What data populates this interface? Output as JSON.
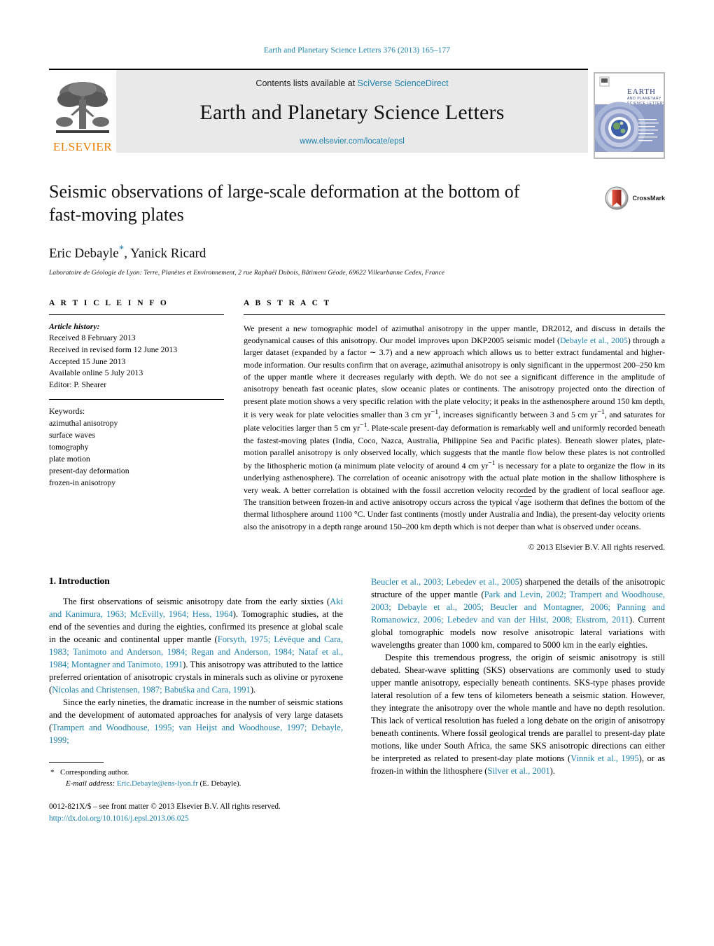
{
  "running_head": "Earth and Planetary Science Letters 376 (2013) 165–177",
  "masthead": {
    "contents_prefix": "Contents lists available at ",
    "sciencedirect_link": "SciVerse ScienceDirect",
    "journal_title": "Earth and Planetary Science Letters",
    "journal_url": "www.elsevier.com/locate/epsl",
    "publisher_wordmark": "ELSEVIER",
    "cover_title_line1": "EARTH",
    "cover_title_line2": "AND PLANETARY",
    "cover_title_line3": "SCIENCE LETTERS"
  },
  "article": {
    "title": "Seismic observations of large-scale deformation at the bottom of fast-moving plates",
    "authors": "Eric Debayle",
    "authors_rest": ", Yanick Ricard",
    "corresponding_marker": "*",
    "affiliation": "Laboratoire de Géologie de Lyon: Terre, Planètes et Environnement, 2 rue Raphaël Dubois, Bâtiment Géode, 69622 Villeurbanne Cedex, France",
    "crossmark_label": "CrossMark"
  },
  "article_info": {
    "heading": "A R T I C L E    I N F O",
    "history_label": "Article history:",
    "history": [
      "Received 8 February 2013",
      "Received in revised form 12 June 2013",
      "Accepted 15 June 2013",
      "Available online 5 July 2013",
      "Editor: P. Shearer"
    ],
    "keywords_label": "Keywords:",
    "keywords": [
      "azimuthal anisotropy",
      "surface waves",
      "tomography",
      "plate motion",
      "present-day deformation",
      "frozen-in anisotropy"
    ]
  },
  "abstract": {
    "heading": "A B S T R A C T",
    "p1": "We present a new tomographic model of azimuthal anisotropy in the upper mantle, DR2012, and discuss in details the geodynamical causes of this anisotropy. Our model improves upon DKP2005 seismic model (",
    "ref1": "Debayle et al., 2005",
    "p2": ") through a larger dataset (expanded by a factor ∼ 3.7) and a new approach which allows us to better extract fundamental and higher-mode information. Our results confirm that on average, azimuthal anisotropy is only significant in the uppermost 200–250 km of the upper mantle where it decreases regularly with depth. We do not see a significant difference in the amplitude of anisotropy beneath fast oceanic plates, slow oceanic plates or continents. The anisotropy projected onto the direction of present plate motion shows a very specific relation with the plate velocity; it peaks in the asthenosphere around 150 km depth, it is very weak for plate velocities smaller than 3 cm yr",
    "sup1": "−1",
    "p3": ", increases significantly between 3 and 5 cm yr",
    "sup2": "−1",
    "p4": ", and saturates for plate velocities larger than 5 cm yr",
    "sup3": "−1",
    "p5": ". Plate-scale present-day deformation is remarkably well and uniformly recorded beneath the fastest-moving plates (India, Coco, Nazca, Australia, Philippine Sea and Pacific plates). Beneath slower plates, plate-motion parallel anisotropy is only observed locally, which suggests that the mantle flow below these plates is not controlled by the lithospheric motion (a minimum plate velocity of around 4 cm yr",
    "sup4": "−1",
    "p6": " is necessary for a plate to organize the flow in its underlying asthenosphere). The correlation of oceanic anisotropy with the actual plate motion in the shallow lithosphere is very weak. A better correlation is obtained with the fossil accretion velocity recorded by the gradient of local seafloor age. The transition between frozen-in and active anisotropy occurs across the typical ",
    "sqrt_label": "age",
    "p7": " isotherm that defines the bottom of the thermal lithosphere around 1100 °C. Under fast continents (mostly under Australia and India), the present-day velocity orients also the anisotropy in a depth range around 150–200 km depth which is not deeper than what is observed under oceans.",
    "copyright": "© 2013 Elsevier B.V. All rights reserved."
  },
  "introduction": {
    "heading": "1. Introduction",
    "left_para1_a": "The first observations of seismic anisotropy date from the early sixties (",
    "left_para1_ref1": "Aki and Kanimura, 1963; McEvilly, 1964; Hess, 1964",
    "left_para1_b": "). Tomographic studies, at the end of the seventies and during the eighties, confirmed its presence at global scale in the oceanic and continental upper mantle (",
    "left_para1_ref2": "Forsyth, 1975; Lévêque and Cara, 1983; Tanimoto and Anderson, 1984; Regan and Anderson, 1984; Nataf et al., 1984; Montagner and Tanimoto, 1991",
    "left_para1_c": "). This anisotropy was attributed to the lattice preferred orientation of anisotropic crystals in minerals such as olivine or pyroxene (",
    "left_para1_ref3": "Nicolas and Christensen, 1987; Babuška and Cara, 1991",
    "left_para1_d": ").",
    "left_para2_a": "Since the early nineties, the dramatic increase in the number of seismic stations and the development of automated approaches for analysis of very large datasets (",
    "left_para2_ref1": "Trampert and Woodhouse, 1995; van Heijst and Woodhouse, 1997; Debayle, 1999;",
    "right_para1_ref1": "Beucler et al., 2003; Lebedev et al., 2005",
    "right_para1_a": ") sharpened the details of the anisotropic structure of the upper mantle (",
    "right_para1_ref2": "Park and Levin, 2002; Trampert and Woodhouse, 2003; Debayle et al., 2005; Beucler and Montagner, 2006; Panning and Romanowicz, 2006; Lebedev and van der Hilst, 2008; Ekstrom, 2011",
    "right_para1_b": "). Current global tomographic models now resolve anisotropic lateral variations with wavelengths greater than 1000 km, compared to 5000 km in the early eighties.",
    "right_para2_a": "Despite this tremendous progress, the origin of seismic anisotropy is still debated. Shear-wave splitting (SKS) observations are commonly used to study upper mantle anisotropy, especially beneath continents. SKS-type phases provide lateral resolution of a few tens of kilometers beneath a seismic station. However, they integrate the anisotropy over the whole mantle and have no depth resolution. This lack of vertical resolution has fueled a long debate on the origin of anisotropy beneath continents. Where fossil geological trends are parallel to present-day plate motions, like under South Africa, the same SKS anisotropic directions can either be interpreted as related to present-day plate motions (",
    "right_para2_ref1": "Vinnik et al., 1995",
    "right_para2_b": "), or as frozen-in within the lithosphere (",
    "right_para2_ref2": "Silver et al., 2001",
    "right_para2_c": ")."
  },
  "footer": {
    "corresponding": "Corresponding author.",
    "email_label": "E-mail address:",
    "email": "Eric.Debayle@ens-lyon.fr",
    "email_suffix": " (E. Debayle).",
    "imprint": "0012-821X/$ – see front matter © 2013 Elsevier B.V. All rights reserved.",
    "doi": "http://dx.doi.org/10.1016/j.epsl.2013.06.025"
  },
  "colors": {
    "link": "#1a7fab",
    "elsevier_orange": "#ef7d00",
    "crossmark_red": "#c0392b"
  }
}
